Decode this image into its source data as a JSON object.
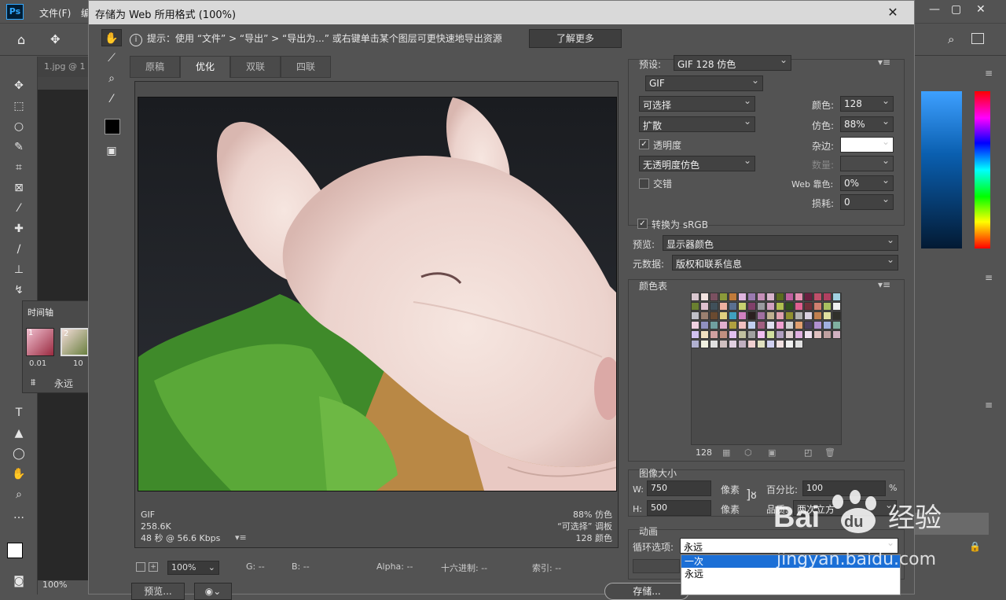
{
  "ps": {
    "logo": "Ps",
    "menu_file": "文件(F)",
    "menu_edit": "编",
    "doc_tab": "1.jpg @ 1",
    "zoom_bottom": "100%",
    "timeline_title": "时间轴",
    "frame1_time": "0.01",
    "frame2_time": "10",
    "frame1_num": "1",
    "frame2_num": "2",
    "loop_value": "永远"
  },
  "dialog": {
    "title": "存储为 Web 所用格式 (100%)",
    "close_icon": "close-icon",
    "hint": "提示：使用 “文件” > “导出” > “导出为...” 或右键单击某个图层可更快速地导出资源",
    "learn_more": "了解更多",
    "tabs": [
      {
        "label": "原稿"
      },
      {
        "label": "优化"
      },
      {
        "label": "双联"
      },
      {
        "label": "四联"
      }
    ],
    "active_tab": "优化",
    "info_left": [
      "GIF",
      "258.6K",
      "48 秒 @ 56.6 Kbps"
    ],
    "info_right": [
      "88% 仿色",
      "“可选择” 调板",
      "128 颜色"
    ],
    "status": {
      "zoom": "100%",
      "g": "G: --",
      "b": "B: --",
      "alpha": "Alpha: --",
      "hex": "十六进制: --",
      "index": "索引: --"
    },
    "preview_btn": "预览...",
    "save_btn": "存储..."
  },
  "settings": {
    "preset_label": "预设:",
    "preset_value": "GIF 128 仿色",
    "format": "GIF",
    "reduction": "可选择",
    "dither_algo": "扩散",
    "transparency_label": "透明度",
    "transparency_checked": true,
    "trans_dither": "无透明度仿色",
    "interlace_label": "交错",
    "interlace_checked": false,
    "colors_label": "颜色:",
    "colors_value": "128",
    "dither_label": "仿色:",
    "dither_value": "88%",
    "matte_label": "杂边:",
    "amount_label": "数量:",
    "web_snap_label": "Web 靠色:",
    "web_snap_value": "0%",
    "lossy_label": "损耗:",
    "lossy_value": "0",
    "convert_srgb_label": "转换为 sRGB",
    "convert_srgb_checked": true,
    "preview_label": "预览:",
    "preview_value": "显示器颜色",
    "metadata_label": "元数据:",
    "metadata_value": "版权和联系信息",
    "color_table_label": "颜色表",
    "color_count": "128",
    "image_size_label": "图像大小",
    "w_label": "W:",
    "w_value": "750",
    "h_label": "H:",
    "h_value": "500",
    "px": "像素",
    "percent_label": "百分比:",
    "percent_value": "100",
    "percent_unit": "%",
    "quality_label": "品质:",
    "quality_value": "两次立方",
    "animation_label": "动画",
    "loop_label": "循环选项:",
    "loop_value": "永远",
    "loop_options": [
      "一次",
      "永远"
    ],
    "loop_selected_index": 0
  },
  "watermark": {
    "brand": "Bai",
    "brand2": "du",
    "word": "经验",
    "url": "jingyan.baidu.com"
  },
  "palette_colors": [
    "#d9c7cf",
    "#f2e3e0",
    "#7a5060",
    "#8b9a3a",
    "#c07a3a",
    "#e0b6e0",
    "#9a7ab0",
    "#c58fb8",
    "#d8b4cc",
    "#5a6b20",
    "#c060a0",
    "#e68fb0",
    "#6a2040",
    "#c0506a",
    "#b04060",
    "#a0d0e0",
    "#6a8030",
    "#e0c0d0",
    "#40505a",
    "#f0b0a0",
    "#5a7090",
    "#c8d070",
    "#80406a",
    "#9a9aa0",
    "#d0a0c0",
    "#b0c050",
    "#305020",
    "#e06090",
    "#70303a",
    "#d08070",
    "#a8c060",
    "#f0f0f0",
    "#c0c0c8",
    "#9a8070",
    "#6a4a30",
    "#e0d080",
    "#40a0c0",
    "#d080c0",
    "#2a2020",
    "#a070a0",
    "#c0b090",
    "#e0a0b0",
    "#909030",
    "#b0b0b0",
    "#d8d0e0",
    "#c08050",
    "#e0e0a0",
    "#30302a",
    "#f0d0e0",
    "#9090c0",
    "#70a0a0",
    "#e0b0d0",
    "#b0a040",
    "#f0c0c0",
    "#c0d0f0",
    "#a06080",
    "#e0e0f0",
    "#f0a0d0",
    "#d0d0d0",
    "#e0a070",
    "#4a4060",
    "#b090d0",
    "#a0b0e0",
    "#80b0a0",
    "#d0c0f0",
    "#f0e0c0",
    "#d0a0a0",
    "#c09080",
    "#e0c0f0",
    "#c0c0a0",
    "#a0a0a0",
    "#f0c0f0",
    "#d0e0a0",
    "#b0a0c0",
    "#e0d0d0",
    "#e0b0e0",
    "#f0e0f0",
    "#e0c0c0",
    "#c0a0a0",
    "#d0b0c0",
    "#b0b0d0",
    "#f0f0e0",
    "#e0e0e0",
    "#d0c0c0",
    "#e0d0e0",
    "#c0b0c0",
    "#f0d0d0",
    "#e0e0c0",
    "#d0d0f0",
    "#f0e0e0",
    "#f0f0f0",
    "#e0e0e0"
  ]
}
